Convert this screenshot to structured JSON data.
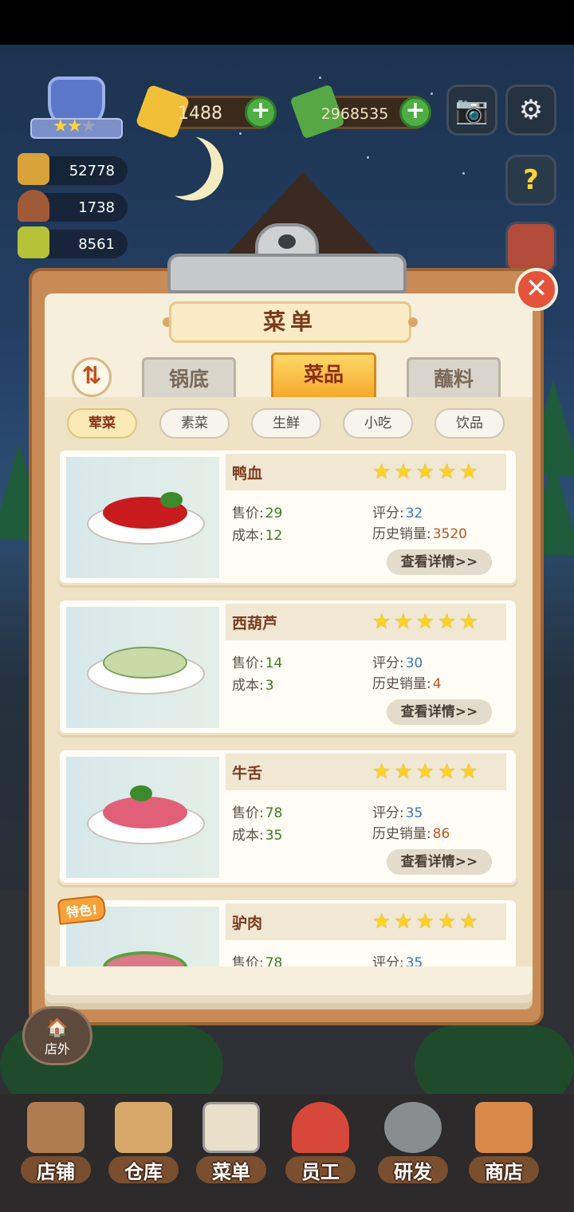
{
  "hud": {
    "rank_stars_on": "★★",
    "rank_stars_off": "★",
    "stats": [
      {
        "icon": "chef-hat-icon",
        "value": "52778"
      },
      {
        "icon": "cloche-icon",
        "value": "1738"
      },
      {
        "icon": "recipe-book-icon",
        "value": "8561"
      }
    ],
    "gems": "1488",
    "cash": "2968535",
    "plus": "+",
    "camera_icon": "📷",
    "settings_icon": "⚙",
    "help_icon": "?"
  },
  "menu": {
    "title": "菜单",
    "close_symbol": "✕",
    "sort_symbol": "⇅",
    "tabs": [
      "锅底",
      "菜品",
      "蘸料"
    ],
    "subtabs": [
      "荤菜",
      "素菜",
      "生鲜",
      "小吃",
      "饮品"
    ],
    "labels": {
      "price": "售价:",
      "cost": "成本:",
      "score": "评分:",
      "sales": "历史销量:",
      "detail": "查看详情>>",
      "special": "特色!"
    },
    "dishes": [
      {
        "name": "鸭血",
        "stars": "★★★★★",
        "price": "29",
        "cost": "12",
        "score": "32",
        "sales": "3520",
        "food_color": "#c81b1f"
      },
      {
        "name": "西葫芦",
        "stars": "★★★★★",
        "price": "14",
        "cost": "3",
        "score": "30",
        "sales": "4",
        "food_color": "#c9d9a8"
      },
      {
        "name": "牛舌",
        "stars": "★★★★★",
        "price": "78",
        "cost": "35",
        "score": "35",
        "sales": "86",
        "food_color": "#e0607a"
      },
      {
        "name": "驴肉",
        "stars": "★★★★★",
        "price": "78",
        "cost": "",
        "score": "35",
        "sales": "",
        "food_color": "#d97a86"
      }
    ]
  },
  "outside": {
    "label": "店外",
    "icon": "🏠"
  },
  "nav": [
    {
      "label": "店铺",
      "icon": "shop-building-icon"
    },
    {
      "label": "仓库",
      "icon": "warehouse-boxes-icon"
    },
    {
      "label": "菜单",
      "icon": "clipboard-menu-icon"
    },
    {
      "label": "员工",
      "icon": "staff-chef-icon"
    },
    {
      "label": "研发",
      "icon": "research-pot-icon"
    },
    {
      "label": "商店",
      "icon": "store-icon"
    }
  ],
  "colors": {
    "accent": "#f5a92a",
    "title_brown": "#7a3b1d",
    "price_green": "#3f7a25",
    "score_blue": "#3a78c2",
    "sales_orange": "#c4541d"
  }
}
